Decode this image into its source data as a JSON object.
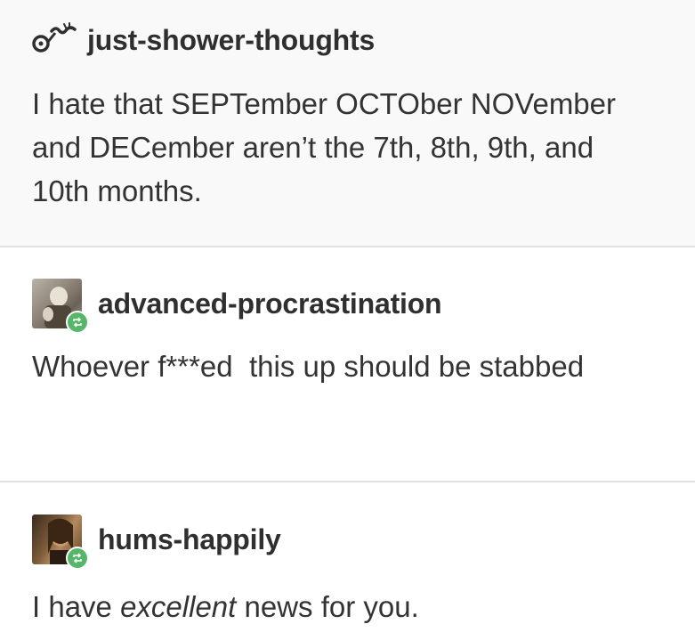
{
  "posts": [
    {
      "username": "just-shower-thoughts",
      "avatar": "glasses-mustache-logo-icon",
      "text": "I hate that SEPTember OCTOber NOVember and DECember aren’t the 7th, 8th, 9th, and 10th months."
    },
    {
      "username": "advanced-procrastination",
      "avatar": "profile-photo",
      "badge": "reblog-icon",
      "text": "Whoever f***ed  this up should be stabbed"
    },
    {
      "username": "hums-happily",
      "avatar": "profile-photo",
      "badge": "reblog-icon",
      "text_before": "I have ",
      "text_emphasis": "excellent",
      "text_after": " news for you."
    }
  ],
  "colors": {
    "reblog_badge": "#56b76a",
    "divider": "#e2e2e2",
    "text": "#333333"
  }
}
